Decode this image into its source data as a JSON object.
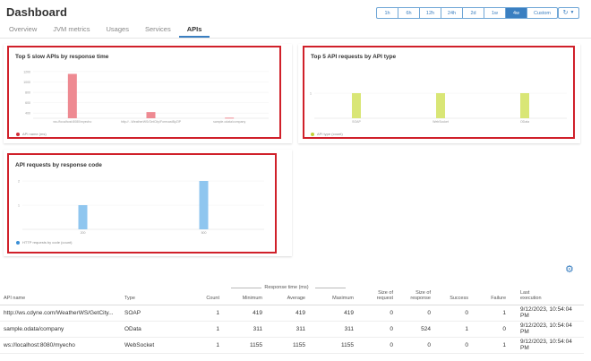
{
  "page": {
    "title": "Dashboard",
    "time_ranges": [
      "1h",
      "6h",
      "12h",
      "24h",
      "2d",
      "1w",
      "4w",
      "Custom"
    ],
    "active_range": "4w",
    "tabs": [
      "Overview",
      "JVM metrics",
      "Usages",
      "Services",
      "APIs"
    ],
    "active_tab": "APIs"
  },
  "colors": {
    "accent": "#3a7fc1",
    "highlight_frame": "#d0202a",
    "slow_bar": "#ee8a92",
    "type_bar": "#d9e676",
    "code_bar": "#8fc6ef"
  },
  "chart_data": [
    {
      "type": "bar",
      "title": "Top 5 slow APIs by response time",
      "categories": [
        "ws://localhost:8080/myecho",
        "http://...WeatherWS/GetCity/ForecastByZIP",
        "sample.odata/company"
      ],
      "values": [
        1155,
        419,
        311
      ],
      "yticks": [
        400,
        600,
        800,
        1000,
        1200
      ],
      "legend": "API name (ms)",
      "legend_color": "#ee8a92"
    },
    {
      "type": "bar",
      "title": "Top 5 API requests by API type",
      "categories": [
        "SOAP",
        "WebSocket",
        "OData"
      ],
      "values": [
        1,
        1,
        1
      ],
      "yticks": [
        1
      ],
      "legend": "API type (count)",
      "legend_color": "#d9e676"
    },
    {
      "type": "bar",
      "title": "API requests by response code",
      "categories": [
        "200",
        "500"
      ],
      "values": [
        1,
        2
      ],
      "yticks": [
        1,
        2
      ],
      "legend": "HTTP requests by code (count)",
      "legend_color": "#8fc6ef"
    }
  ],
  "table": {
    "group_header": "Response time (ms)",
    "headers": {
      "api_name": "API name",
      "type": "Type",
      "count": "Count",
      "minimum": "Minimum",
      "average": "Average",
      "maximum": "Maximum",
      "size_request": [
        "Size of",
        "request"
      ],
      "size_response": [
        "Size of",
        "response"
      ],
      "success": "Success",
      "failure": "Failure",
      "last_execution": [
        "Last",
        "execution"
      ]
    },
    "rows": [
      {
        "api_name": "http://ws.cdyne.com/WeatherWS/GetCity...",
        "type": "SOAP",
        "count": "1",
        "minimum": "419",
        "average": "419",
        "maximum": "419",
        "size_request": "0",
        "size_response": "0",
        "success": "0",
        "failure": "1",
        "last_execution": "9/12/2023, 10:54:04 PM"
      },
      {
        "api_name": "sample.odata/company",
        "type": "OData",
        "count": "1",
        "minimum": "311",
        "average": "311",
        "maximum": "311",
        "size_request": "0",
        "size_response": "524",
        "success": "1",
        "failure": "0",
        "last_execution": "9/12/2023, 10:54:04 PM"
      },
      {
        "api_name": "ws://localhost:8080/myecho",
        "type": "WebSocket",
        "count": "1",
        "minimum": "1155",
        "average": "1155",
        "maximum": "1155",
        "size_request": "0",
        "size_response": "0",
        "success": "0",
        "failure": "1",
        "last_execution": "9/12/2023, 10:54:04 PM"
      }
    ]
  }
}
